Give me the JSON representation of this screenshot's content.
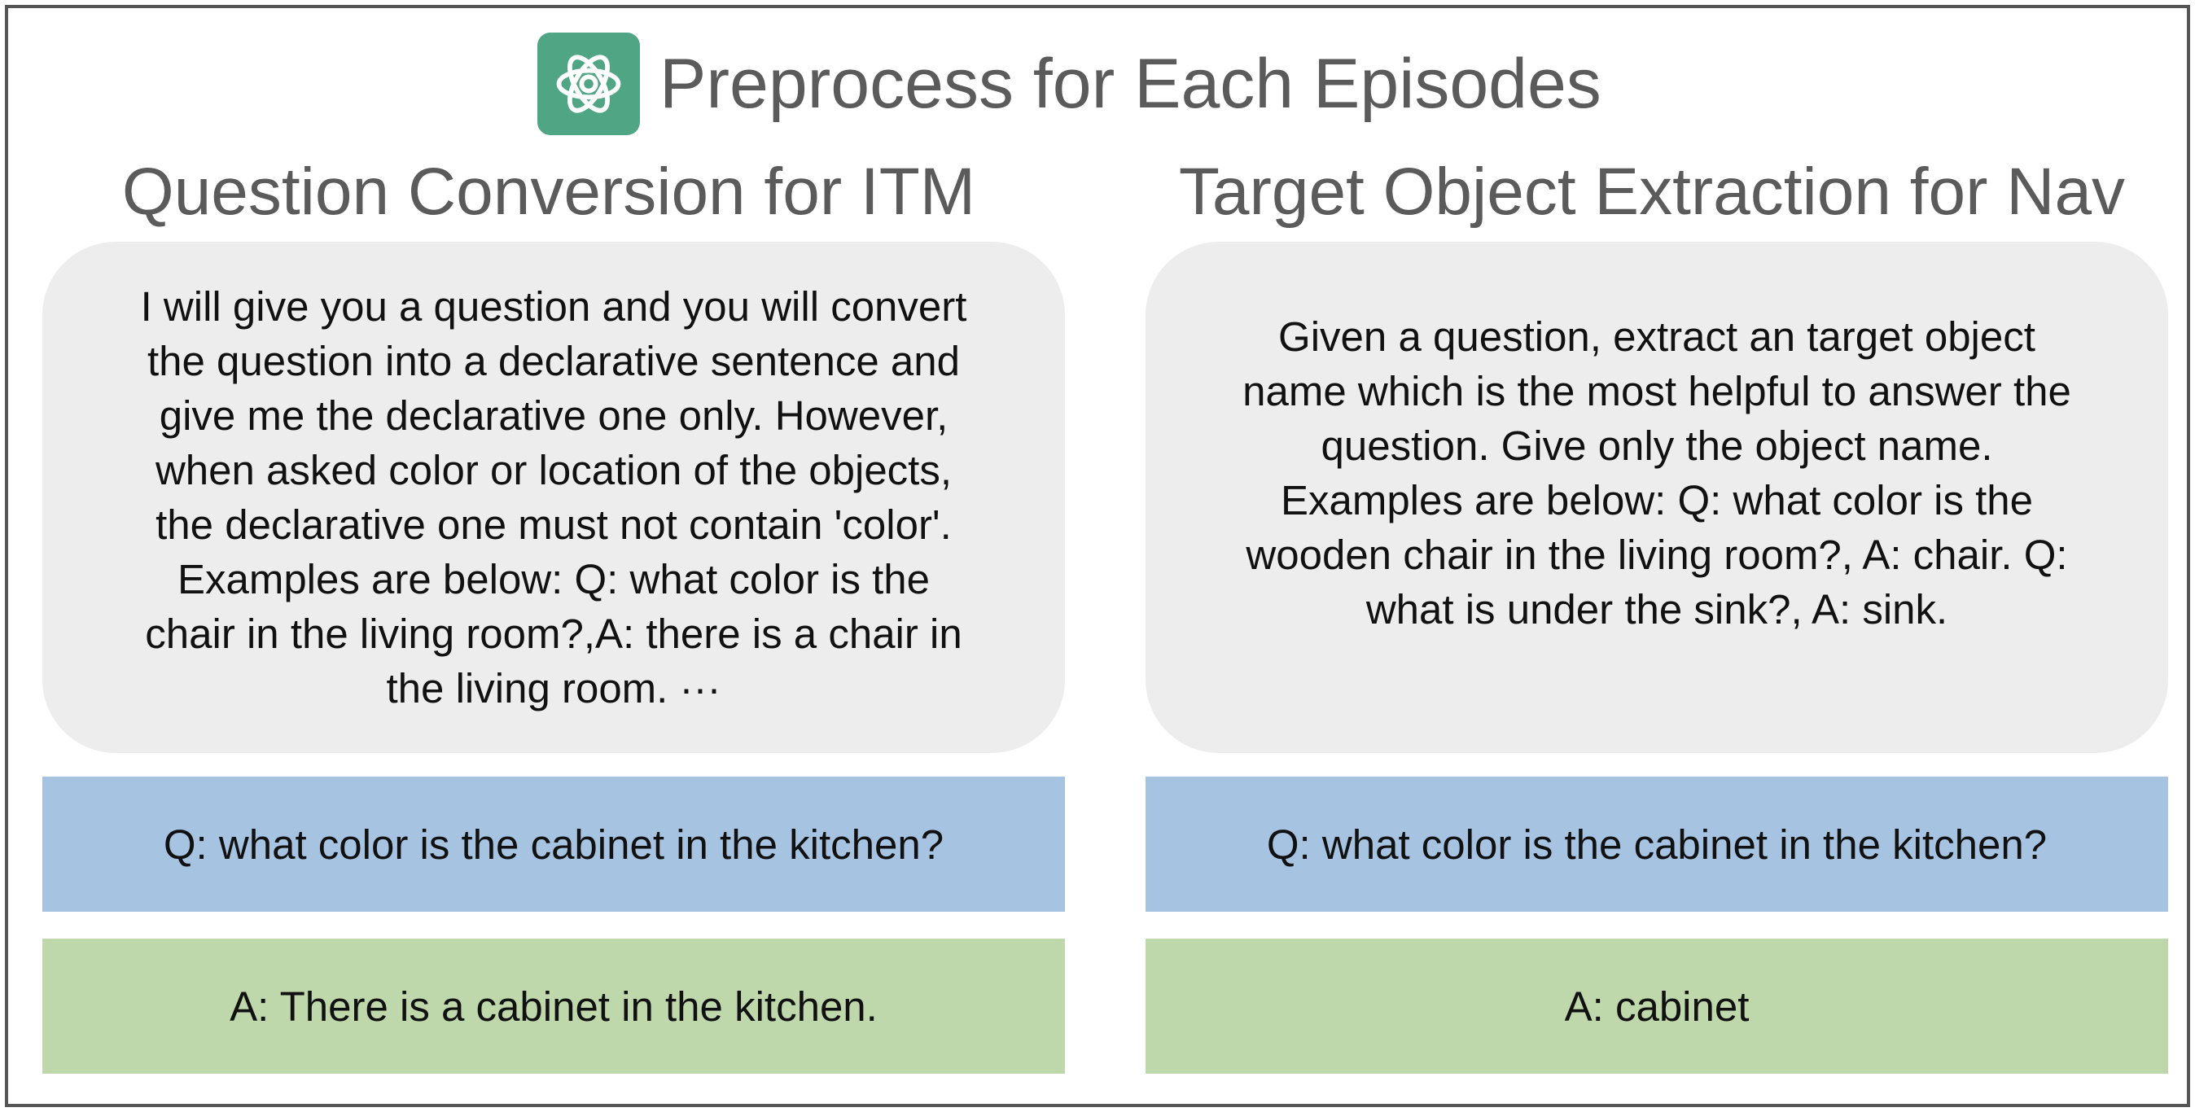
{
  "header": {
    "title": "Preprocess for Each Episodes",
    "logo_icon": "openai-logo-icon",
    "logo_color": "#4fa584"
  },
  "left_panel": {
    "title": "Question Conversion for ITM",
    "prompt_lines": [
      "I will give you a question and you will convert",
      "the question into a declarative sentence and",
      "give me the declarative one only. However,",
      "when asked color or location of the objects,",
      "the declarative one must not contain 'color'.",
      "Examples are below: Q: what color is the",
      "chair in the living room?,A: there is a chair in",
      "the living room. ···"
    ],
    "question": "Q: what color is the cabinet in the kitchen?",
    "answer": "A: There is a cabinet in the kitchen."
  },
  "right_panel": {
    "title": "Target Object Extraction for Nav",
    "prompt_lines": [
      "Given a question, extract an target object",
      "name which is the most helpful to answer the",
      "question. Give only the object name.",
      "Examples are below: Q: what color is the",
      "wooden chair in the living room?, A: chair. Q:",
      "what is under the sink?, A: sink."
    ],
    "question": "Q: what color is the cabinet in the kitchen?",
    "answer": "A: cabinet"
  },
  "colors": {
    "bubble": "#ededed",
    "question_box": "#a7c3e2",
    "answer_box": "#bed7ab",
    "title_text": "#5b5b5b"
  }
}
